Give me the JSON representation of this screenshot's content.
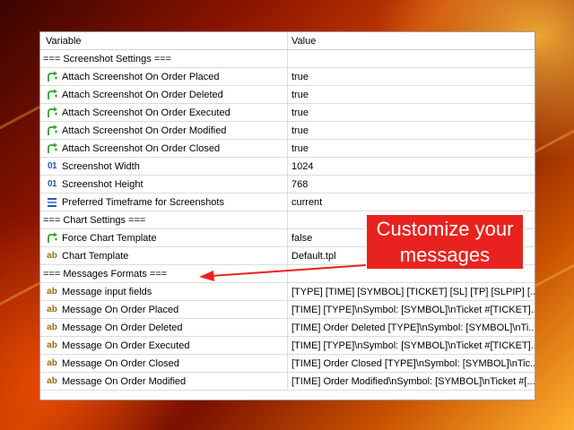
{
  "table": {
    "headers": {
      "variable": "Variable",
      "value": "Value"
    },
    "rows": [
      {
        "type": "section",
        "name": "=== Screenshot Settings ===",
        "value": ""
      },
      {
        "type": "bool",
        "icon": "toggle-arrow-icon",
        "name": "Attach Screenshot On Order Placed",
        "value": "true"
      },
      {
        "type": "bool",
        "icon": "toggle-arrow-icon",
        "name": "Attach Screenshot On Order Deleted",
        "value": "true"
      },
      {
        "type": "bool",
        "icon": "toggle-arrow-icon",
        "name": "Attach Screenshot On Order Executed",
        "value": "true"
      },
      {
        "type": "bool",
        "icon": "toggle-arrow-icon",
        "name": "Attach Screenshot On Order Modified",
        "value": "true"
      },
      {
        "type": "bool",
        "icon": "toggle-arrow-icon",
        "name": "Attach Screenshot On Order Closed",
        "value": "true"
      },
      {
        "type": "int",
        "icon": "integer-icon",
        "name": "Screenshot Width",
        "value": "1024"
      },
      {
        "type": "int",
        "icon": "integer-icon",
        "name": "Screenshot Height",
        "value": "768"
      },
      {
        "type": "enum",
        "icon": "list-icon",
        "name": "Preferred Timeframe for Screenshots",
        "value": "current"
      },
      {
        "type": "section",
        "name": "=== Chart Settings ===",
        "value": ""
      },
      {
        "type": "bool",
        "icon": "toggle-arrow-icon",
        "name": "Force Chart Template",
        "value": "false"
      },
      {
        "type": "string",
        "icon": "string-icon",
        "name": "Chart Template",
        "value": "Default.tpl"
      },
      {
        "type": "section",
        "name": "=== Messages Formats ===",
        "value": ""
      },
      {
        "type": "string",
        "icon": "string-icon",
        "name": "Message input fields",
        "value": "[TYPE] [TIME] [SYMBOL] [TICKET] [SL] [TP] [SLPIP] [..."
      },
      {
        "type": "string",
        "icon": "string-icon",
        "name": "Message On Order Placed",
        "value": "[TIME] [TYPE]\\nSymbol: [SYMBOL]\\nTicket #[TICKET]..."
      },
      {
        "type": "string",
        "icon": "string-icon",
        "name": "Message On Order Deleted",
        "value": "[TIME] Order Deleted [TYPE]\\nSymbol: [SYMBOL]\\nTi..."
      },
      {
        "type": "string",
        "icon": "string-icon",
        "name": "Message On Order Executed",
        "value": "[TIME] [TYPE]\\nSymbol: [SYMBOL]\\nTicket #[TICKET]..."
      },
      {
        "type": "string",
        "icon": "string-icon",
        "name": "Message On Order Closed",
        "value": "[TIME] Order Closed [TYPE]\\nSymbol: [SYMBOL]\\nTic..."
      },
      {
        "type": "string",
        "icon": "string-icon",
        "name": "Message On Order Modified",
        "value": "[TIME] Order Modified\\nSymbol: [SYMBOL]\\nTicket #[..."
      }
    ]
  },
  "callout": {
    "line1": "Customize your",
    "line2": "messages"
  },
  "colors": {
    "callout": "#e8231f",
    "bool_icon": "#2aa52a",
    "int_icon": "#2a5ba8",
    "string_icon": "#9c6a10"
  }
}
